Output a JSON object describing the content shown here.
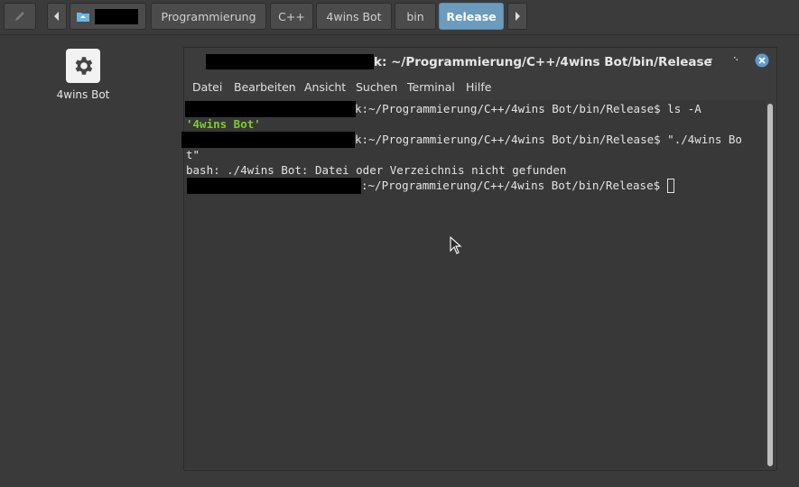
{
  "pathbar": {
    "crumbs": [
      "Programmierung",
      "C++",
      "4wins Bot",
      "bin",
      "Release"
    ],
    "active": "Release"
  },
  "desktop": {
    "icon_label": "4wins Bot"
  },
  "terminal": {
    "title": "k: ~/Programmierung/C++/4wins Bot/bin/Release",
    "menu": [
      "Datei",
      "Bearbeiten",
      "Ansicht",
      "Suchen",
      "Terminal",
      "Hilfe"
    ],
    "lines": {
      "l1": "k:~/Programmierung/C++/4wins Bot/bin/Release$ ls -A",
      "l2": "'4wins Bot'",
      "l3": "k:~/Programmierung/C++/4wins Bot/bin/Release$ \"./4wins Bo",
      "l4": "t\"",
      "l5": "bash: ./4wins Bot: Datei oder Verzeichnis nicht gefunden",
      "l6": ":~/Programmierung/C++/4wins Bot/bin/Release$ "
    }
  },
  "colors": {
    "accent": "#6b9bbd",
    "close": "#5b9ad1",
    "ls_green": "#7ccd2b"
  }
}
